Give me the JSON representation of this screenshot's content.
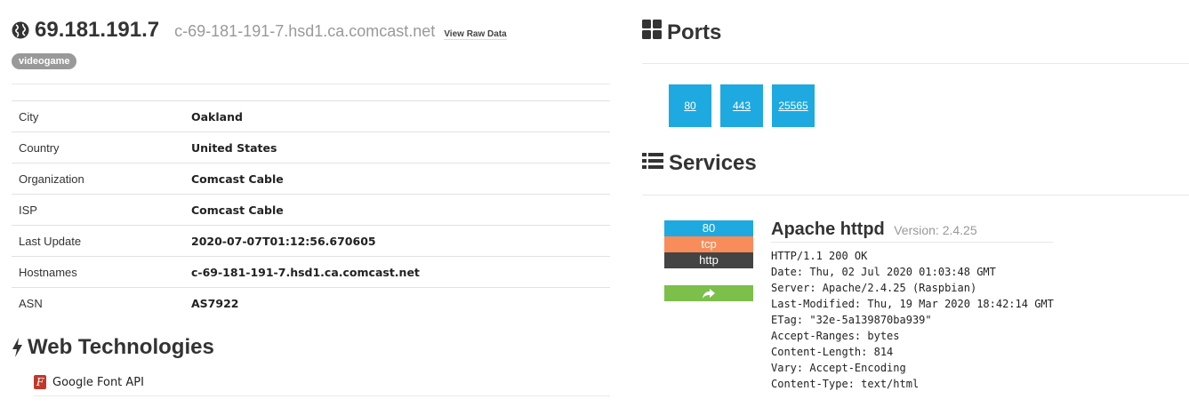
{
  "host": {
    "ip": "69.181.191.7",
    "hostname": "c-69-181-191-7.hsd1.ca.comcast.net",
    "raw_data_label": "View Raw Data",
    "tag": "videogame"
  },
  "details": [
    {
      "key": "City",
      "value": "Oakland"
    },
    {
      "key": "Country",
      "value": "United States"
    },
    {
      "key": "Organization",
      "value": "Comcast Cable"
    },
    {
      "key": "ISP",
      "value": "Comcast Cable"
    },
    {
      "key": "Last Update",
      "value": "2020-07-07T01:12:56.670605"
    },
    {
      "key": "Hostnames",
      "value": "c-69-181-191-7.hsd1.ca.comcast.net"
    },
    {
      "key": "ASN",
      "value": "AS7922"
    }
  ],
  "web_technologies": {
    "title": "Web Technologies",
    "items": [
      {
        "name": "Google Font API",
        "icon": "font-icon"
      }
    ]
  },
  "ports": {
    "title": "Ports",
    "list": [
      "80",
      "443",
      "25565"
    ]
  },
  "services": {
    "title": "Services",
    "entries": [
      {
        "port": "80",
        "transport": "tcp",
        "module": "http",
        "product": "Apache httpd",
        "version_label": "Version: 2.4.25",
        "banner": "HTTP/1.1 200 OK\nDate: Thu, 02 Jul 2020 01:03:48 GMT\nServer: Apache/2.4.25 (Raspbian)\nLast-Modified: Thu, 19 Mar 2020 18:42:14 GMT\nETag: \"32e-5a139870ba939\"\nAccept-Ranges: bytes\nContent-Length: 814\nVary: Accept-Encoding\nContent-Type: text/html"
      }
    ]
  },
  "colors": {
    "port_blue": "#1ea9e1",
    "tcp_orange": "#f98c5b",
    "module_dark": "#444444",
    "link_green": "#7cbf4a"
  }
}
